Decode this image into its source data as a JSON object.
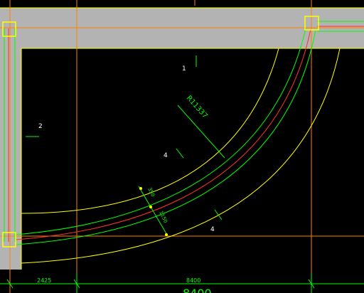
{
  "colors": {
    "background": "#000000",
    "slab": "#b3b3b3",
    "axis": "#ff8000",
    "boundary": "#ffff00",
    "beam": "#00ff00",
    "centerline": "#ff3030",
    "dimension": "#00ff00",
    "label": "#ffffff"
  },
  "labels": {
    "region_1": "1",
    "region_2": "2",
    "region_4a": "4",
    "region_4b": "4"
  },
  "dimensions": {
    "radius": "R11337",
    "beam_width": "350",
    "offset": "1150",
    "span_left": "2425",
    "span_main": "8400",
    "total": "8400"
  }
}
